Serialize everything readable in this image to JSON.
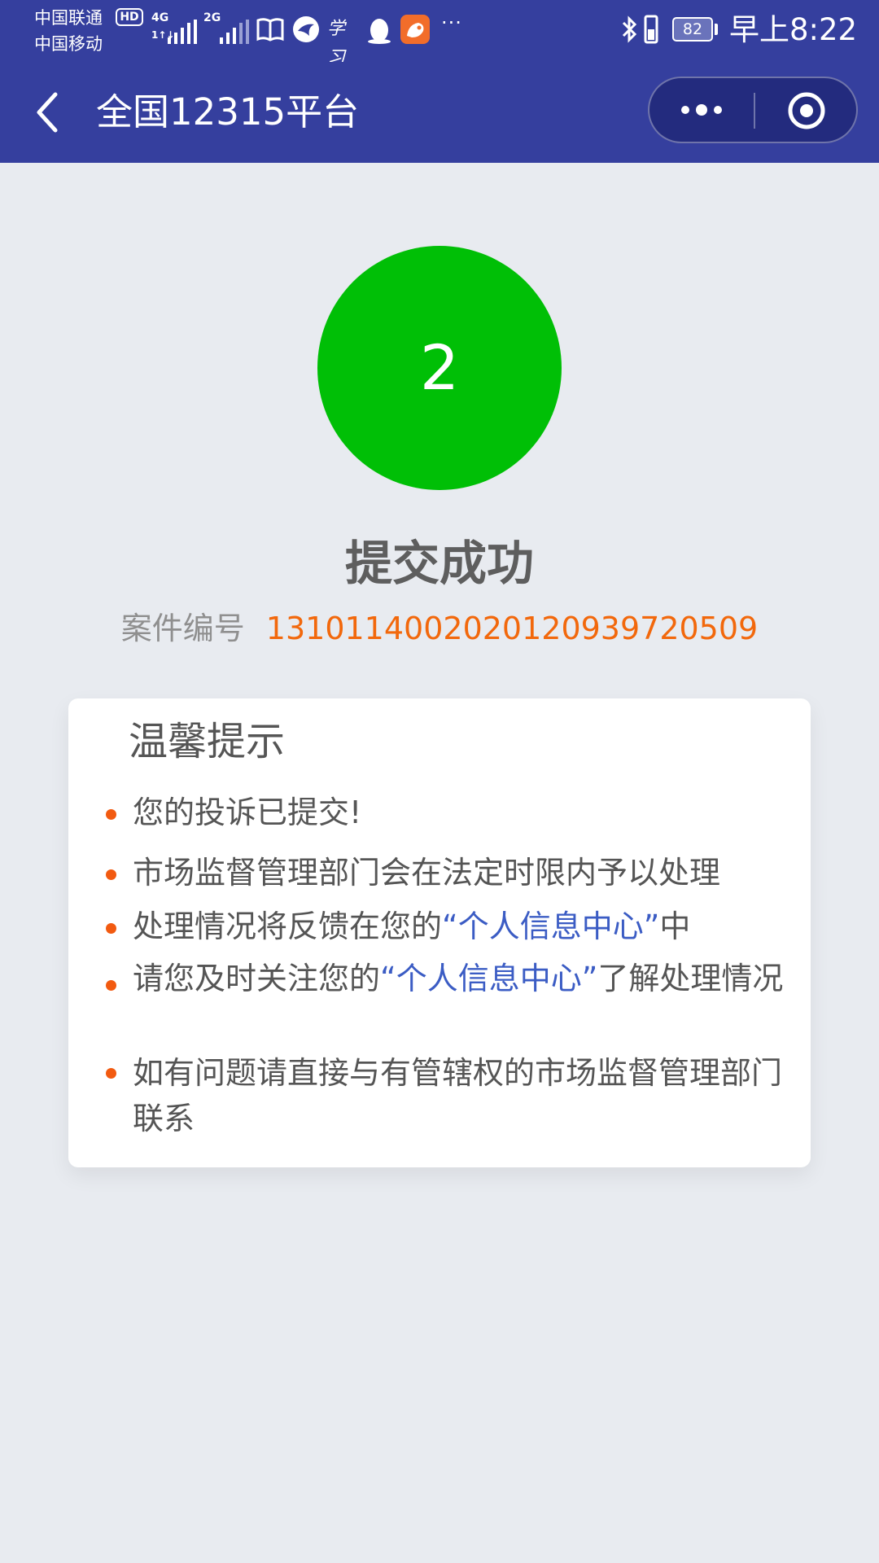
{
  "status_bar": {
    "carrier_1": "中国联通",
    "carrier_2": "中国移动",
    "hd_badge": "HD",
    "network_1": "4G",
    "network_1_sub": "1↑↓",
    "network_2": "2G",
    "app_icons": [
      "book-icon",
      "bird-icon",
      "xuexi-icon",
      "penguin-icon",
      "uc-browser-icon"
    ],
    "xuexi_text": "学习",
    "more": "···",
    "battery": "82",
    "time": "早上8:22"
  },
  "navbar": {
    "title": "全国12315平台"
  },
  "result": {
    "step_number": "2",
    "title": "提交成功",
    "case_label": "案件编号",
    "case_number": "13101140020201209397205​09"
  },
  "tips": {
    "title": "温馨提示",
    "items": [
      {
        "text": "您的投诉已提交!"
      },
      {
        "text": "市场监督管理部门会在法定时限内予以处理"
      },
      {
        "before": "处理情况将反馈在您的",
        "link": "“个人信息中心”",
        "after": "中"
      },
      {
        "before": "请您及时关注您的",
        "link": "“个人信息中心”",
        "after": "了解处理情况"
      },
      {
        "text": "如有问题请直接与有管辖权的市场监督管理部门联系"
      }
    ]
  },
  "colors": {
    "primary": "#353f9e",
    "success": "#00bf06",
    "accent": "#f2680c",
    "link": "#3b5cc4",
    "background": "#e8ebf0"
  }
}
